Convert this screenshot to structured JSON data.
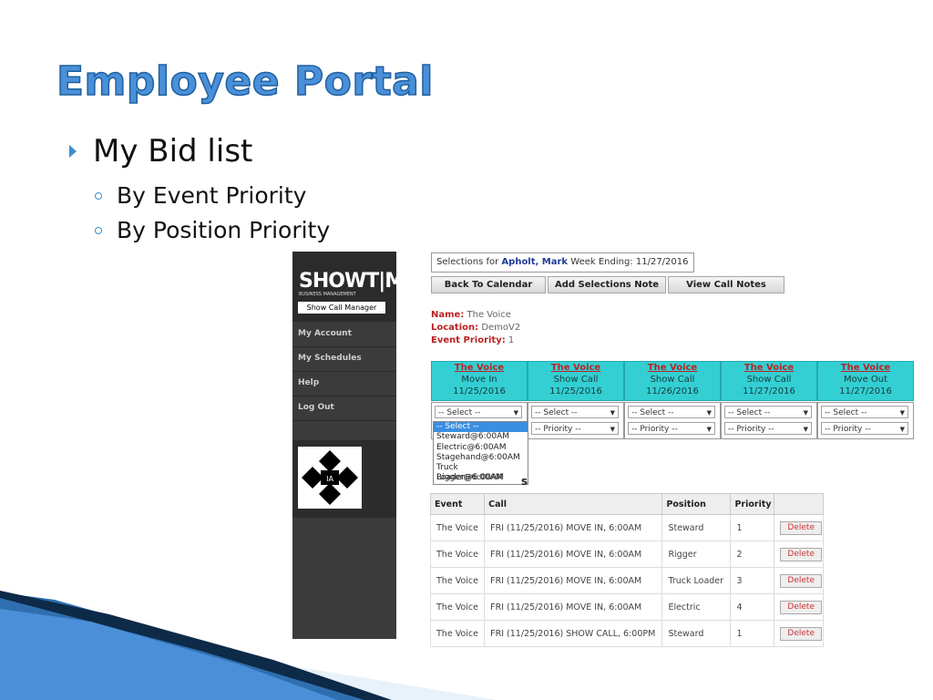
{
  "slide": {
    "title": "Employee Portal",
    "bullet_main": "My Bid list",
    "bullet_sub1": "By Event Priority",
    "bullet_sub2": "By Position Priority"
  },
  "sidebar": {
    "logo_text": "SHOWT|ME",
    "logo_sub": "BUSINESS MANAGEMENT",
    "logo_button": "Show Call Manager",
    "items": [
      "My Account",
      "My Schedules",
      "Help",
      "Log Out"
    ]
  },
  "selections": {
    "prefix": "Selections for",
    "name": "Apholt, Mark",
    "week": "Week Ending: 11/27/2016"
  },
  "buttons": {
    "back": "Back To Calendar",
    "add_note": "Add Selections Note",
    "view_notes": "View Call Notes"
  },
  "event": {
    "name_label": "Name:",
    "name": "The Voice",
    "location_label": "Location:",
    "location": "DemoV2",
    "priority_label": "Event Priority:",
    "priority": "1"
  },
  "cards": [
    {
      "name": "The Voice",
      "sub": "Move In",
      "date": "11/25/2016"
    },
    {
      "name": "The Voice",
      "sub": "Show Call",
      "date": "11/25/2016"
    },
    {
      "name": "The Voice",
      "sub": "Show Call",
      "date": "11/26/2016"
    },
    {
      "name": "The Voice",
      "sub": "Show Call",
      "date": "11/27/2016"
    },
    {
      "name": "The Voice",
      "sub": "Move Out",
      "date": "11/27/2016"
    }
  ],
  "select_placeholder": "-- Select --",
  "priority_placeholder": "-- Priority --",
  "dropdown_options": [
    "-- Select --",
    "Steward@6:00AM",
    "Electric@6:00AM",
    "Stagehand@6:00AM",
    "Truck Loader@6:00AM",
    "Rigger@6:00AM"
  ],
  "partial_label": "s",
  "table": {
    "headers": [
      "Event",
      "Call",
      "Position",
      "Priority",
      ""
    ],
    "rows": [
      [
        "The Voice",
        "FRI (11/25/2016) MOVE IN, 6:00AM",
        "Steward",
        "1"
      ],
      [
        "The Voice",
        "FRI (11/25/2016) MOVE IN, 6:00AM",
        "Rigger",
        "2"
      ],
      [
        "The Voice",
        "FRI (11/25/2016) MOVE IN, 6:00AM",
        "Truck Loader",
        "3"
      ],
      [
        "The Voice",
        "FRI (11/25/2016) MOVE IN, 6:00AM",
        "Electric",
        "4"
      ],
      [
        "The Voice",
        "FRI (11/25/2016) SHOW CALL, 6:00PM",
        "Steward",
        "1"
      ]
    ],
    "delete_label": "Delete"
  }
}
